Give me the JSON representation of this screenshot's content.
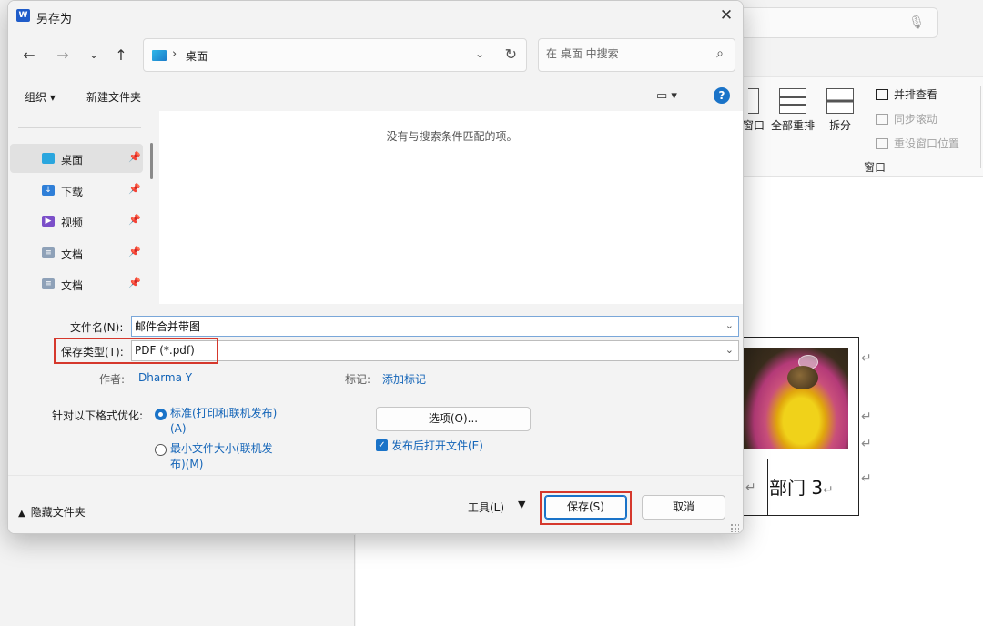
{
  "dialog": {
    "title": "另存为",
    "app_icon": "word-icon",
    "close_label": "✕"
  },
  "nav": {
    "path": "桌面",
    "search_placeholder": "在 桌面 中搜索"
  },
  "toolbar": {
    "organize": "组织 ▾",
    "new_folder": "新建文件夹"
  },
  "sidebar": {
    "items": [
      {
        "label": "桌面",
        "icon": "desktop-icon",
        "color": "#2aa6de",
        "selected": true
      },
      {
        "label": "下载",
        "icon": "download-icon",
        "color": "#2f7fd8",
        "selected": false
      },
      {
        "label": "视频",
        "icon": "video-icon",
        "color": "#7b4fc9",
        "selected": false
      },
      {
        "label": "文档",
        "icon": "document-icon",
        "color": "#8ea1b8",
        "selected": false
      },
      {
        "label": "文档",
        "icon": "document-icon",
        "color": "#8ea1b8",
        "selected": false
      }
    ]
  },
  "file_area": {
    "empty_message": "没有与搜索条件匹配的项。"
  },
  "form": {
    "filename_label": "文件名(N):",
    "filename_value": "邮件合并带图",
    "type_label": "保存类型(T):",
    "type_value": "PDF (*.pdf)",
    "author_label": "作者:",
    "author_value": "Dharma Y",
    "tags_label": "标记:",
    "tags_value": "添加标记",
    "optimize_label": "针对以下格式优化:",
    "opt_standard_1": "标准(打印和联机发布)",
    "opt_standard_2": "(A)",
    "opt_min_1": "最小文件大小(联机发",
    "opt_min_2": "布)(M)",
    "options_button": "选项(O)...",
    "open_after_label": "发布后打开文件(E)"
  },
  "footer": {
    "hide_folders": "隐藏文件夹",
    "tools": "工具(L)",
    "save": "保存(S)",
    "cancel": "取消"
  },
  "background": {
    "ribbon": {
      "btn_window_partial": "窗口",
      "btn_arrange_all": "全部重排",
      "btn_split": "拆分",
      "side_by_side": "并排查看",
      "sync_scroll": "同步滚动",
      "reset_position": "重设窗口位置",
      "group_label": "窗口"
    },
    "doc": {
      "dept_text": "部门 3"
    }
  },
  "colors": {
    "accent": "#1a73c8",
    "highlight_box": "#d5382c"
  }
}
